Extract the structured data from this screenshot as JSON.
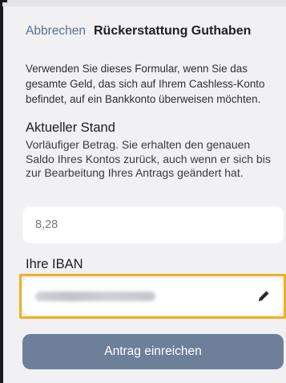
{
  "header": {
    "cancel_label": "Abbrechen",
    "title": "Rückerstattung Guthaben"
  },
  "intro_text": "Verwenden Sie dieses Formular, wenn Sie das gesamte Geld, das sich auf Ihrem Cashless-Konto befindet, auf ein Bankkonto überweisen möchten.",
  "balance": {
    "heading": "Aktueller Stand",
    "description": "Vorläufiger Betrag. Sie erhalten den genauen Saldo Ihres Kontos zurück, auch wenn er sich bis zur Bearbeitung Ihres Antrags geändert hat.",
    "value": "8,28"
  },
  "iban": {
    "heading": "Ihre IBAN",
    "edit_icon": "pencil-icon",
    "highlight_color": "#f0b021"
  },
  "submit_label": "Antrag einreichen",
  "colors": {
    "accent": "#5d6f92",
    "button": "#6e7f9a",
    "background": "#f1f1f3"
  }
}
